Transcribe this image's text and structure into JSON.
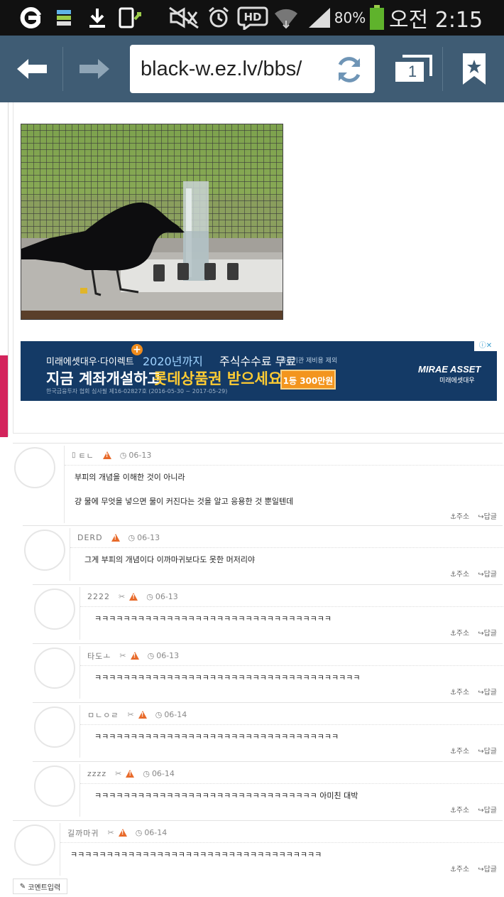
{
  "status_bar": {
    "battery": "80%",
    "time": "오전 2:15",
    "icons": [
      "app-g-icon",
      "bars-icon",
      "download-icon",
      "phone-update-icon",
      "mute-icon",
      "alarm-icon",
      "hd-icon",
      "wifi-icon",
      "signal-icon",
      "battery-icon"
    ]
  },
  "browser": {
    "url": "black-w.ez.lv/bbs/",
    "tab_count": "1"
  },
  "ad": {
    "line1_brand": "미래에셋대우·다이렉트",
    "line1_highlight": "2020년까지",
    "line1_text": "주식수수료 무료",
    "line1_note": "유관기관 제비용 제외",
    "line2_text": "지금 계좌개설하고",
    "line2_highlight": "롯데상품권 받으세요!",
    "badge": "1등 300만원",
    "line3_text": "한국금융투자 협회 심사필 제16-02827호 (2016-05-30 ~ 2017-05-29)",
    "brand": "MIRAE ASSET",
    "brand_sub": "미래에셋대우"
  },
  "comments": [
    {
      "nick": "ㅌㄴ",
      "date": "06-13",
      "lines": [
        "부피의 개념을 이해한 것이 아니라",
        "",
        "걍 물에 무엇을 넣으면 물이 커진다는 것을 알고 응용한 것 뿐일텐데"
      ]
    },
    {
      "nick": "DERD",
      "date": "06-13",
      "lines": [
        "그게 부피의 개념이다 이까마귀보다도 못한 머저리야"
      ]
    },
    {
      "nick": "2222",
      "date": "06-13",
      "lines": [
        "ㅋㅋㅋㅋㅋㅋㅋㅋㅋㅋㅋㅋㅋㅋㅋㅋㅋㅋㅋㅋㅋㅋㅋㅋㅋㅋㅋㅋㅋㅋㅋㅋㅋ"
      ]
    },
    {
      "nick": "타도ㅗ",
      "date": "06-13",
      "lines": [
        "ㅋㅋㅋㅋㅋㅋㅋㅋㅋㅋㅋㅋㅋㅋㅋㅋㅋㅋㅋㅋㅋㅋㅋㅋㅋㅋㅋㅋㅋㅋㅋㅋㅋㅋㅋㅋㅋ"
      ]
    },
    {
      "nick": "ㅁㄴㅇㄹ",
      "date": "06-14",
      "lines": [
        "ㅋㅋㅋㅋㅋㅋㅋㅋㅋㅋㅋㅋㅋㅋㅋㅋㅋㅋㅋㅋㅋㅋㅋㅋㅋㅋㅋㅋㅋㅋㅋㅋㅋㅋ"
      ]
    },
    {
      "nick": "zzzz",
      "date": "06-14",
      "lines": [
        "ㅋㅋㅋㅋㅋㅋㅋㅋㅋㅋㅋㅋㅋㅋㅋㅋㅋㅋㅋㅋㅋㅋㅋㅋㅋㅋㅋㅋㅋㅋㅋ 아미친 대박"
      ]
    },
    {
      "nick": "길까마귀",
      "date": "06-14",
      "lines": [
        "ㅋㅋㅋㅋㅋㅋㅋㅋㅋㅋㅋㅋㅋㅋㅋㅋㅋㅋㅋㅋㅋㅋㅋㅋㅋㅋㅋㅋㅋㅋㅋㅋㅋㅋㅋ"
      ]
    }
  ],
  "comment_actions": {
    "address": "주소",
    "reply": "답글"
  },
  "compose_label": "코멘트입력"
}
